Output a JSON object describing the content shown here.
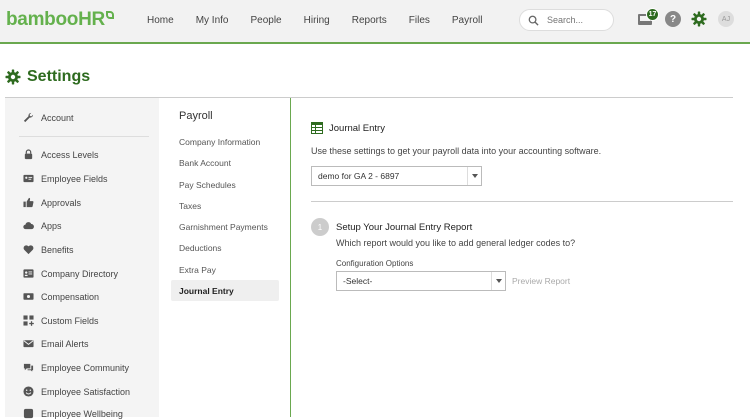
{
  "brand": {
    "logo_text": "bambooHR",
    "accent": "#64b14d",
    "dark_accent": "#2e6b1f"
  },
  "nav": {
    "items": [
      "Home",
      "My Info",
      "People",
      "Hiring",
      "Reports",
      "Files",
      "Payroll"
    ],
    "search_placeholder": "Search...",
    "inbox_count": "17",
    "help_label": "?",
    "avatar_initials": "AJ"
  },
  "page": {
    "title": "Settings"
  },
  "sidebar": {
    "items": [
      {
        "label": "Account",
        "icon": "wrench-icon"
      },
      {
        "label": "Access Levels",
        "icon": "lock-icon"
      },
      {
        "label": "Employee Fields",
        "icon": "id-card-icon"
      },
      {
        "label": "Approvals",
        "icon": "thumbs-up-icon"
      },
      {
        "label": "Apps",
        "icon": "cloud-icon"
      },
      {
        "label": "Benefits",
        "icon": "heart-icon"
      },
      {
        "label": "Company Directory",
        "icon": "directory-icon"
      },
      {
        "label": "Compensation",
        "icon": "money-icon"
      },
      {
        "label": "Custom Fields",
        "icon": "grid-plus-icon"
      },
      {
        "label": "Email Alerts",
        "icon": "envelope-icon"
      },
      {
        "label": "Employee Community",
        "icon": "chat-icon"
      },
      {
        "label": "Employee Satisfaction",
        "icon": "smiley-icon"
      },
      {
        "label": "Employee Wellbeing",
        "icon": "wellbeing-icon"
      }
    ]
  },
  "subnav": {
    "title": "Payroll",
    "items": [
      "Company Information",
      "Bank Account",
      "Pay Schedules",
      "Taxes",
      "Garnishment Payments",
      "Deductions",
      "Extra Pay",
      "Journal Entry"
    ],
    "active": "Journal Entry"
  },
  "main": {
    "heading": "Journal Entry",
    "description": "Use these settings to get your payroll data into your accounting software.",
    "company_select_value": "demo for GA 2 - 6897",
    "step": {
      "number": "1",
      "title": "Setup Your Journal Entry Report",
      "question": "Which report would you like to add general ledger codes to?",
      "config_label": "Configuration Options",
      "config_value": "-Select-",
      "preview_label": "Preview Report"
    }
  }
}
